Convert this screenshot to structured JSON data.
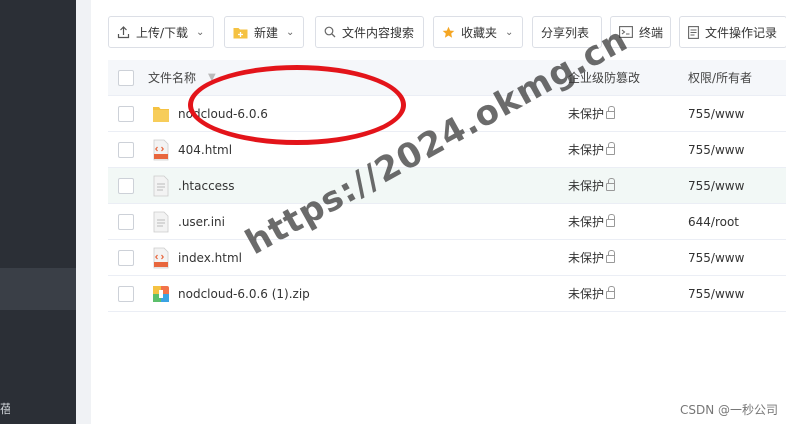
{
  "sidebar": {
    "fragment": "蓓"
  },
  "toolbar": {
    "upload_label": "上传/下载",
    "new_label": "新建",
    "search_label": "文件内容搜索",
    "favorites_label": "收藏夹",
    "share_label": "分享列表",
    "terminal_label": "终端",
    "oplog_label": "文件操作记录"
  },
  "table": {
    "headers": {
      "name": "文件名称",
      "protect": "企业级防篡改",
      "perm": "权限/所有者"
    },
    "rows": [
      {
        "name": "nodcloud-6.0.6",
        "protect": "未保护",
        "perm": "755/www",
        "icon": "folder-icon"
      },
      {
        "name": "404.html",
        "protect": "未保护",
        "perm": "755/www",
        "icon": "html-file-icon"
      },
      {
        "name": ".htaccess",
        "protect": "未保护",
        "perm": "755/www",
        "icon": "text-file-icon"
      },
      {
        "name": ".user.ini",
        "protect": "未保护",
        "perm": "644/root",
        "icon": "text-file-icon"
      },
      {
        "name": "index.html",
        "protect": "未保护",
        "perm": "755/www",
        "icon": "html-file-icon"
      },
      {
        "name": "nodcloud-6.0.6 (1).zip",
        "protect": "未保护",
        "perm": "755/www",
        "icon": "zip-file-icon"
      }
    ]
  },
  "watermark": "https://2024.okmg.cn",
  "credit": "CSDN @一秒公司",
  "colors": {
    "annotation": "#e3141a",
    "folder": "#f5c242",
    "html": "#e8663d"
  }
}
